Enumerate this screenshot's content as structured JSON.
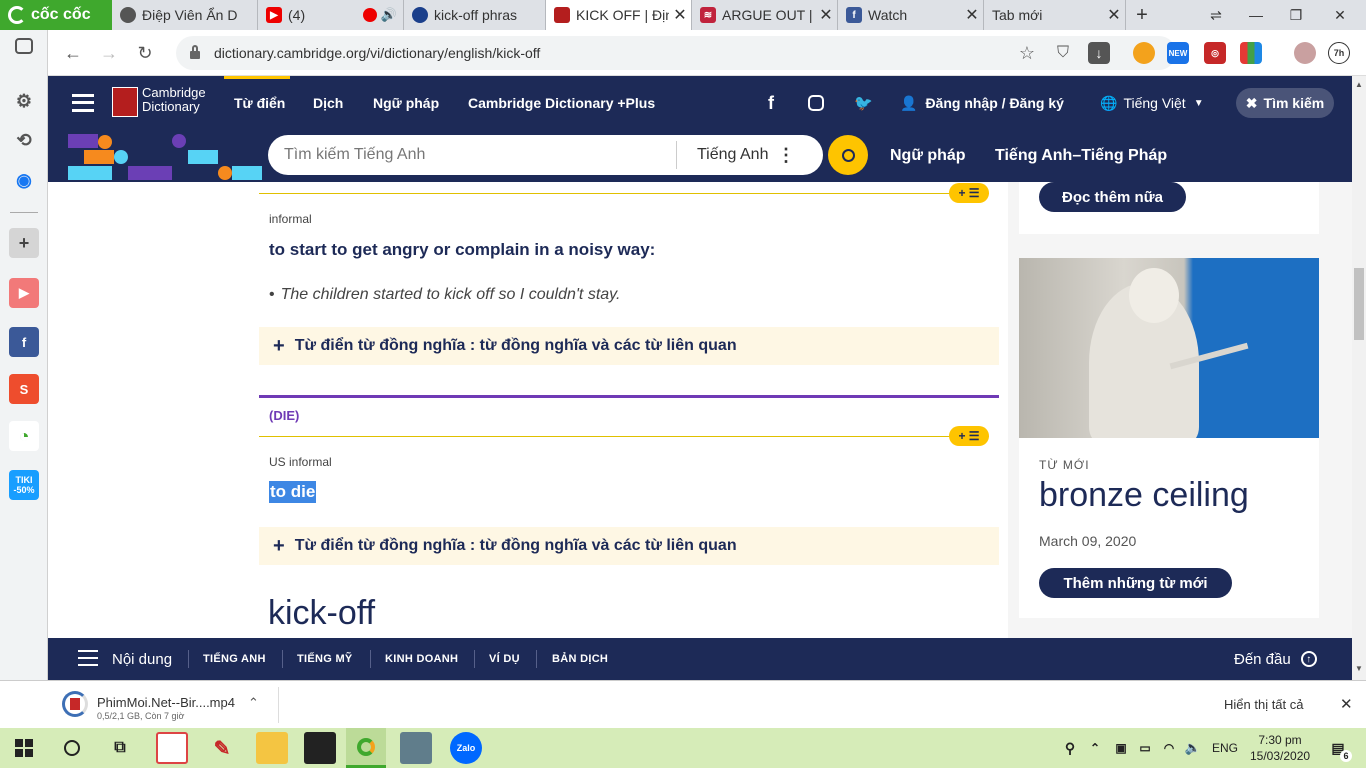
{
  "browser": {
    "brand": "cốc cốc",
    "tabs": [
      {
        "title": "Điệp Viên Ẩn D",
        "icon": "chrome-like-icon"
      },
      {
        "title": "(4)",
        "icon": "youtube-icon"
      },
      {
        "title": "kick-off phras",
        "icon": "phrase-site-icon"
      },
      {
        "title": "KICK OFF | Địn",
        "icon": "cambridge-icon"
      },
      {
        "title": "ARGUE OUT | ",
        "icon": "argue-site-icon"
      },
      {
        "title": "Watch",
        "icon": "facebook-icon"
      },
      {
        "title": "Tab mới",
        "icon": "none"
      }
    ],
    "url": "dictionary.cambridge.org/vi/dictionary/english/kick-off",
    "avatar_badge": "7h"
  },
  "cambridge": {
    "logo_line1": "Cambridge",
    "logo_line2": "Dictionary",
    "nav": [
      "Từ điển",
      "Dịch",
      "Ngữ pháp",
      "Cambridge Dictionary +Plus"
    ],
    "login": "Đăng nhập / Đăng ký",
    "language": "Tiếng Việt",
    "search_button": "Tìm kiếm",
    "search_placeholder": "Tìm kiếm Tiếng Anh",
    "search_lang": "Tiếng Anh",
    "sub_links": [
      "Ngữ pháp",
      "Tiếng Anh–Tiếng Pháp"
    ]
  },
  "entry": {
    "sense1_label": "informal",
    "sense1_def": "to start to get angry or complain in a noisy way:",
    "sense1_example": "The children started to kick off so I couldn't stay.",
    "thesaurus": "Từ điển từ đồng nghĩa : từ đồng nghĩa và các từ liên quan",
    "guide_word": "(DIE)",
    "sense2_label": "US informal",
    "sense2_def": "to die",
    "headword": "kick-off",
    "pill_plus": "+"
  },
  "sidebar": {
    "read_more": "Đọc thêm nữa",
    "new_words_label": "TỪ MỚI",
    "new_word": "bronze ceiling",
    "date": "March 09, 2020",
    "more_new_words": "Thêm những từ mới"
  },
  "bottom_nav": {
    "menu_label": "Nội dung",
    "items": [
      "TIẾNG ANH",
      "TIẾNG MỸ",
      "KINH DOANH",
      "VÍ DỤ",
      "BẢN DỊCH"
    ],
    "to_top": "Đến đầu"
  },
  "download": {
    "file": "PhimMoi.Net--Bir....mp4",
    "status": "0,5/2,1 GB, Còn 7 giờ",
    "show_all": "Hiển thị tất cả"
  },
  "taskbar": {
    "lang": "ENG",
    "time": "7:30 pm",
    "date": "15/03/2020",
    "notifications": "6"
  },
  "colors": {
    "cambridge_navy": "#1d2a57",
    "accent_yellow": "#fec400",
    "guide_purple": "#6f3ab5",
    "coccoc_green": "#3fa82d"
  }
}
